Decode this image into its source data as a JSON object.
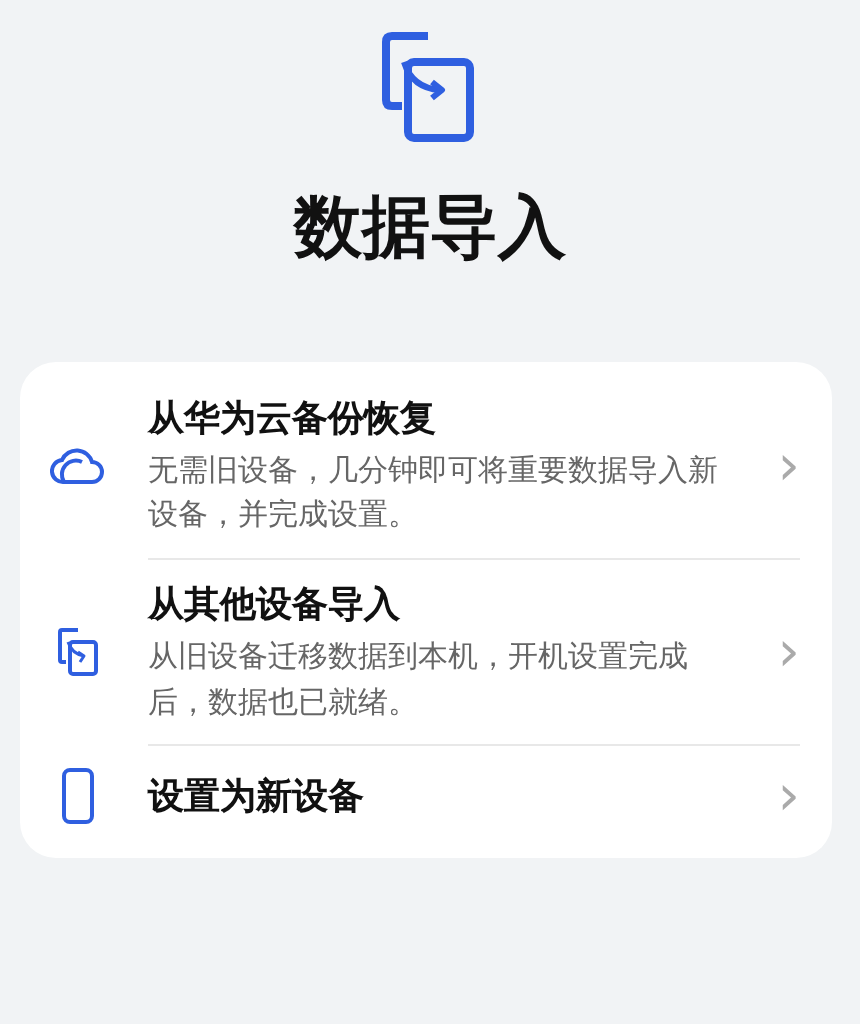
{
  "header": {
    "title": "数据导入"
  },
  "options": [
    {
      "kind": "cloud",
      "title": "从华为云备份恢复",
      "description": "无需旧设备，几分钟即可将重要数据导入新设备，并完成设置。",
      "chevron": "›"
    },
    {
      "kind": "transfer",
      "title": "从其他设备导入",
      "description": "从旧设备迁移数据到本机，开机设置完成后，数据也已就绪。",
      "chevron": "›"
    },
    {
      "kind": "phone",
      "title": "设置为新设备",
      "chevron": "›"
    }
  ]
}
